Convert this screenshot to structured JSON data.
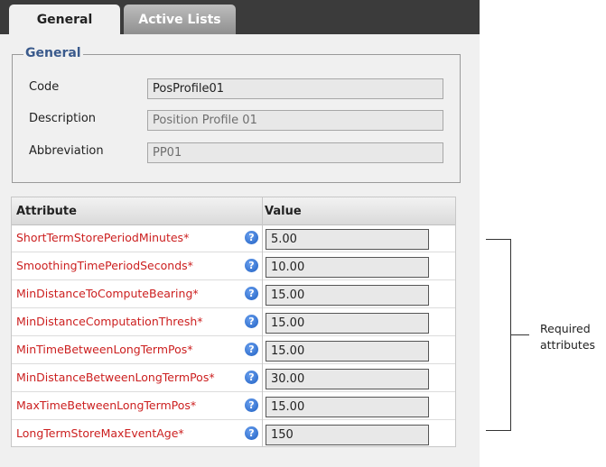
{
  "tabs": [
    {
      "label": "General",
      "active": true
    },
    {
      "label": "Active Lists",
      "active": false
    }
  ],
  "general": {
    "legend": "General",
    "fields": [
      {
        "label": "Code",
        "value": "PosProfile01"
      },
      {
        "label": "Description",
        "value": "Position Profile 01"
      },
      {
        "label": "Abbreviation",
        "value": "PP01"
      }
    ]
  },
  "grid": {
    "headers": {
      "attribute": "Attribute",
      "value": "Value"
    },
    "rows": [
      {
        "attribute": "ShortTermStorePeriodMinutes*",
        "value": "5.00"
      },
      {
        "attribute": "SmoothingTimePeriodSeconds*",
        "value": "10.00"
      },
      {
        "attribute": "MinDistanceToComputeBearing*",
        "value": "15.00"
      },
      {
        "attribute": "MinDistanceComputationThresh*",
        "value": "15.00"
      },
      {
        "attribute": "MinTimeBetweenLongTermPos*",
        "value": "15.00"
      },
      {
        "attribute": "MinDistanceBetweenLongTermPos*",
        "value": "30.00"
      },
      {
        "attribute": "MaxTimeBetweenLongTermPos*",
        "value": "15.00"
      },
      {
        "attribute": "LongTermStoreMaxEventAge*",
        "value": "150"
      }
    ],
    "help_glyph": "?"
  },
  "annotation": {
    "line1": "Required",
    "line2": "attributes"
  },
  "colors": {
    "required_attribute": "#cc2020",
    "legend": "#3a5a8c",
    "help_icon": "#1e5fc2",
    "tabbar": "#3b3b3b"
  },
  "icons": {
    "help": "help-circle-icon"
  }
}
